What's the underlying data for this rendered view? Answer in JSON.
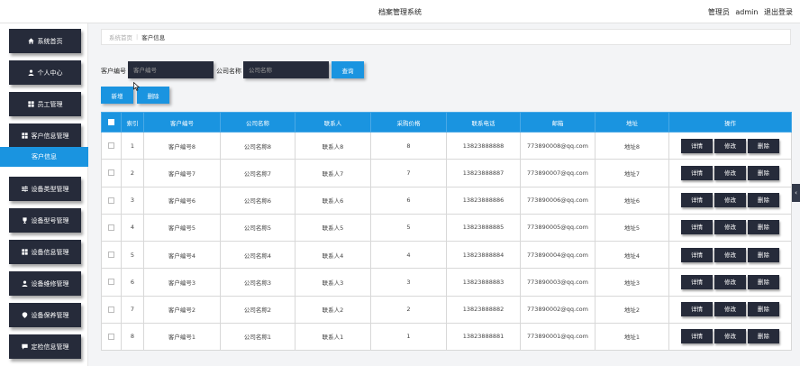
{
  "header": {
    "title": "档案管理系统",
    "user_role": "管理员",
    "user_name": "admin",
    "logout": "退出登录"
  },
  "sidebar": {
    "items": [
      {
        "label": "系统首页",
        "icon": "home-icon"
      },
      {
        "label": "个人中心",
        "icon": "user-icon"
      },
      {
        "label": "员工管理",
        "icon": "grid-icon"
      },
      {
        "label": "客户信息管理",
        "icon": "grid-icon"
      },
      {
        "label": "设备类型管理",
        "icon": "sliders-icon"
      },
      {
        "label": "设备型号管理",
        "icon": "trophy-icon"
      },
      {
        "label": "设备信息管理",
        "icon": "grid-icon"
      },
      {
        "label": "设备维修管理",
        "icon": "user-icon"
      },
      {
        "label": "设备保养管理",
        "icon": "pin-icon"
      },
      {
        "label": "定检信息管理",
        "icon": "chat-icon"
      }
    ],
    "active_sub": "客户信息"
  },
  "breadcrumb": {
    "home": "系统首页",
    "current": "客户信息"
  },
  "search": {
    "label1": "客户编号",
    "placeholder1": "客户编号",
    "label2": "公司名称",
    "placeholder2": "公司名称",
    "query_button": "查询"
  },
  "toolbar": {
    "add_button": "新增",
    "delete_button": "删除"
  },
  "table": {
    "headers": [
      "索引",
      "客户编号",
      "公司名称",
      "联系人",
      "采购价格",
      "联系电话",
      "邮箱",
      "地址",
      "操作"
    ],
    "rows": [
      {
        "index": "1",
        "code": "客户编号8",
        "company": "公司名称8",
        "contact": "联系人8",
        "price": "8",
        "phone": "13823888888",
        "email": "773890008@qq.com",
        "address": "地址8"
      },
      {
        "index": "2",
        "code": "客户编号7",
        "company": "公司名称7",
        "contact": "联系人7",
        "price": "7",
        "phone": "13823888887",
        "email": "773890007@qq.com",
        "address": "地址7"
      },
      {
        "index": "3",
        "code": "客户编号6",
        "company": "公司名称6",
        "contact": "联系人6",
        "price": "6",
        "phone": "13823888886",
        "email": "773890006@qq.com",
        "address": "地址6"
      },
      {
        "index": "4",
        "code": "客户编号5",
        "company": "公司名称5",
        "contact": "联系人5",
        "price": "5",
        "phone": "13823888885",
        "email": "773890005@qq.com",
        "address": "地址5"
      },
      {
        "index": "5",
        "code": "客户编号4",
        "company": "公司名称4",
        "contact": "联系人4",
        "price": "4",
        "phone": "13823888884",
        "email": "773890004@qq.com",
        "address": "地址4"
      },
      {
        "index": "6",
        "code": "客户编号3",
        "company": "公司名称3",
        "contact": "联系人3",
        "price": "3",
        "phone": "13823888883",
        "email": "773890003@qq.com",
        "address": "地址3"
      },
      {
        "index": "7",
        "code": "客户编号2",
        "company": "公司名称2",
        "contact": "联系人2",
        "price": "2",
        "phone": "13823888882",
        "email": "773890002@qq.com",
        "address": "地址2"
      },
      {
        "index": "8",
        "code": "客户编号1",
        "company": "公司名称1",
        "contact": "联系人1",
        "price": "1",
        "phone": "13823888881",
        "email": "773890001@qq.com",
        "address": "地址1"
      }
    ],
    "actions": {
      "detail": "详情",
      "edit": "修改",
      "delete": "删除"
    }
  },
  "colors": {
    "accent": "#1a94e0",
    "dark": "#262b3a"
  }
}
